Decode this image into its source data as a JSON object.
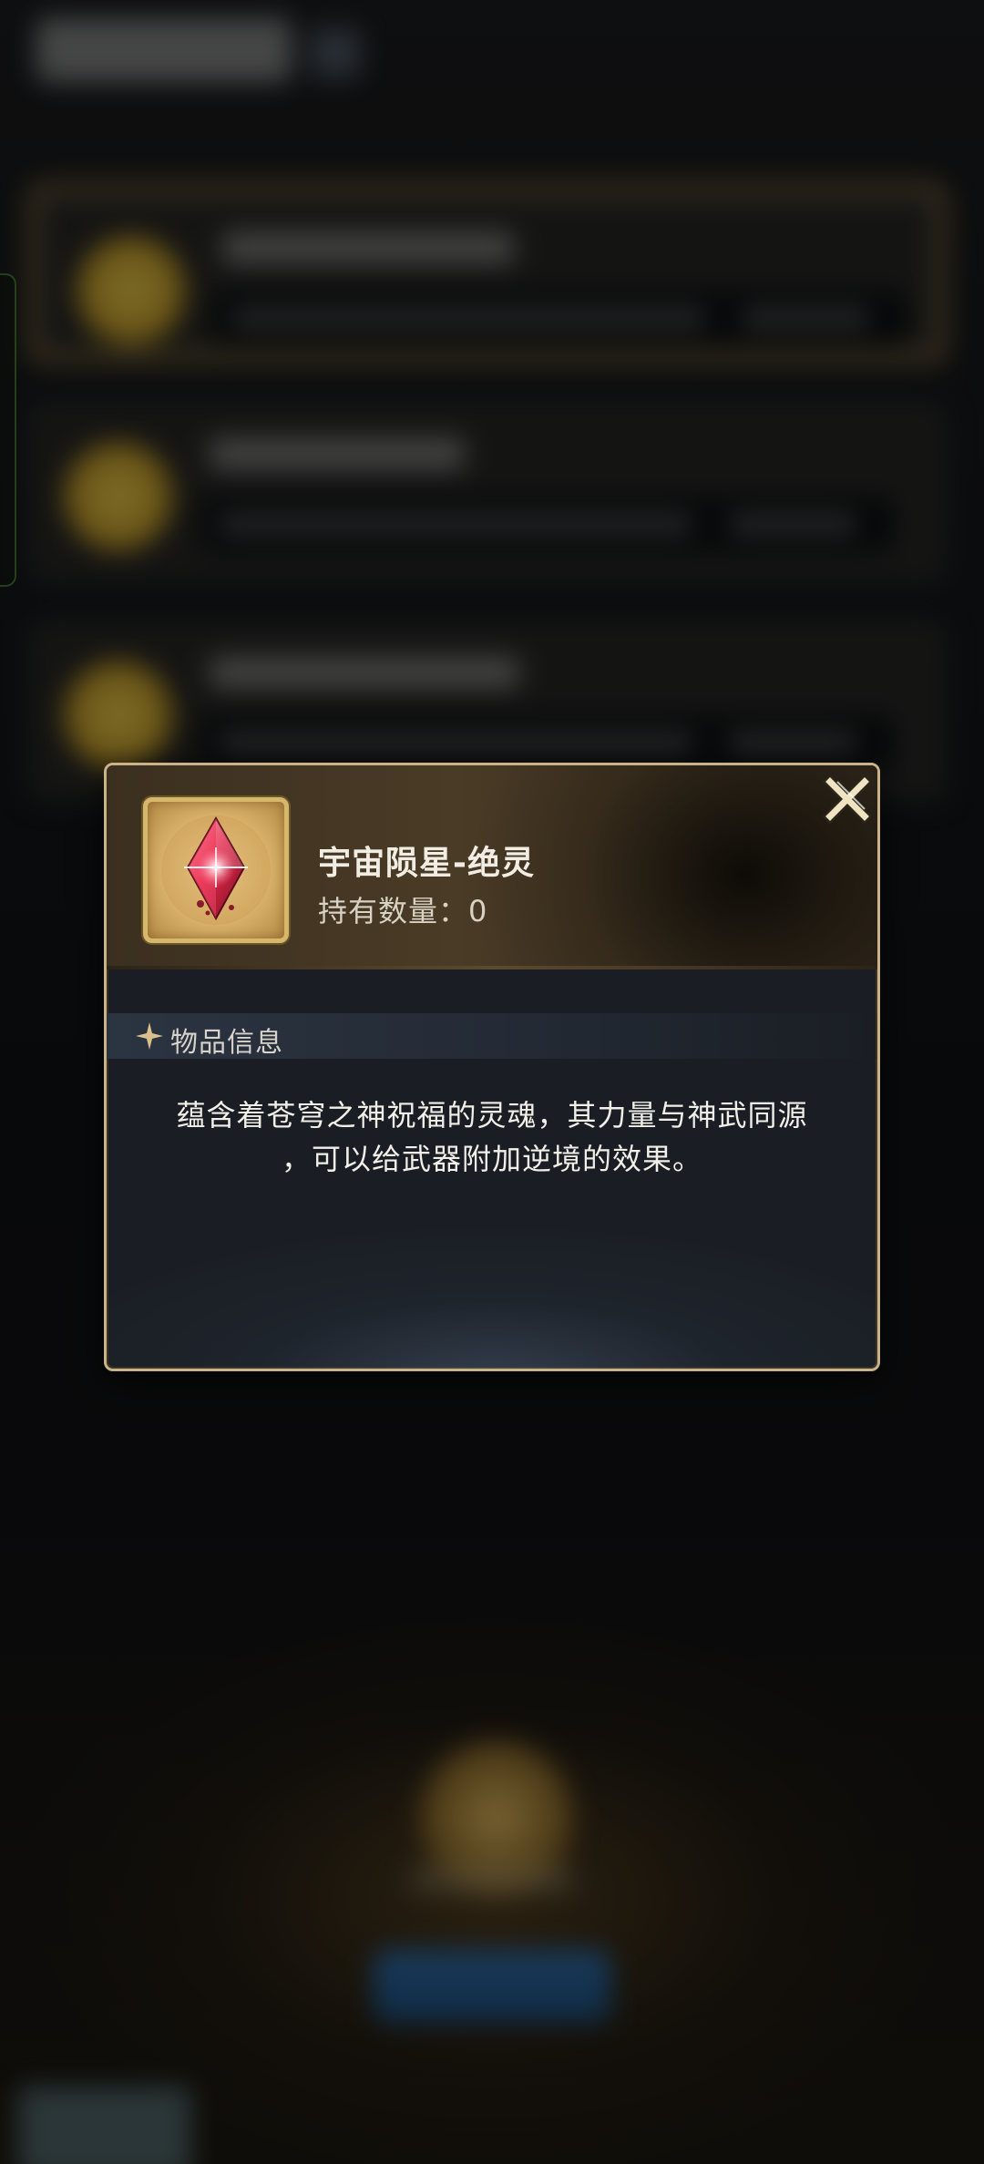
{
  "popup": {
    "item_name": "宇宙陨星-绝灵",
    "item_count": "持有数量：0",
    "section_title": "物品信息",
    "description_line1": "蕴含着苍穹之神祝福的灵魂，其力量与神武同源",
    "description_line2": "，可以给武器附加逆境的效果。",
    "item_icon": "red-crystal-icon",
    "close_icon": "close-x-icon"
  },
  "colors": {
    "border_gold": "#c9b387",
    "item_frame_gold": "#d6b86c",
    "crystal_red": "#e0294a",
    "text_light": "#f2efe8"
  }
}
